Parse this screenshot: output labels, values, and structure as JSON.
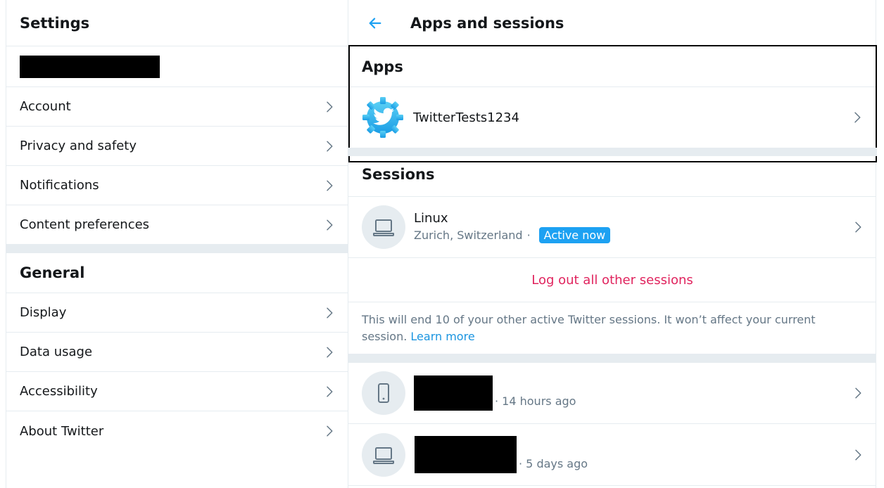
{
  "left": {
    "header_title": "Settings",
    "account_section": [
      {
        "label": "Account",
        "name": "account"
      },
      {
        "label": "Privacy and safety",
        "name": "privacy-and-safety"
      },
      {
        "label": "Notifications",
        "name": "notifications"
      },
      {
        "label": "Content preferences",
        "name": "content-preferences"
      }
    ],
    "general_title": "General",
    "general_section": [
      {
        "label": "Display",
        "name": "display"
      },
      {
        "label": "Data usage",
        "name": "data-usage"
      },
      {
        "label": "Accessibility",
        "name": "accessibility"
      },
      {
        "label": "About Twitter",
        "name": "about-twitter"
      }
    ]
  },
  "right": {
    "header_title": "Apps and sessions",
    "apps_title": "Apps",
    "app_name": "TwitterTests1234",
    "sessions_title": "Sessions",
    "current_session": {
      "device": "Linux",
      "location": "Zurich, Switzerland",
      "separator": "·",
      "badge": "Active now"
    },
    "logout_label": "Log out all other sessions",
    "note_text": "This will end 10 of your other active Twitter sessions. It won’t affect your current session.",
    "learn_more": "Learn more",
    "other_sessions": [
      {
        "time": "· 14 hours ago",
        "device_icon": "phone-icon"
      },
      {
        "time": "· 5 days ago",
        "device_icon": "laptop-icon"
      }
    ]
  },
  "colors": {
    "accent": "#1da1f2",
    "danger": "#e0245e",
    "border": "#e6ecf0",
    "muted": "#657786"
  }
}
